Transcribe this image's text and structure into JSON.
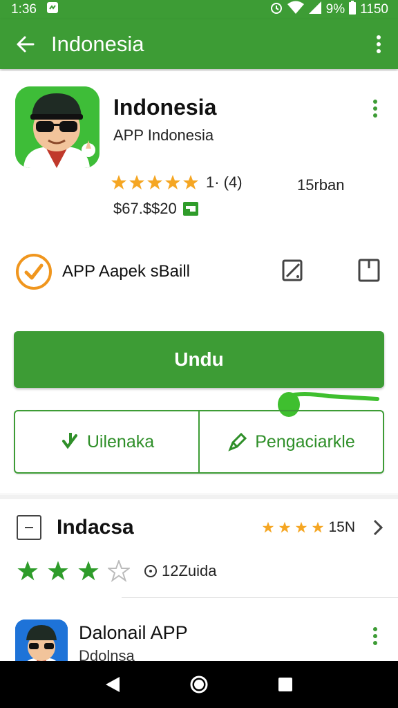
{
  "status_bar": {
    "time": "1:36",
    "battery": "9%",
    "clock_right": "1150",
    "icons": [
      "notification-icon",
      "alarm-icon",
      "wifi-icon",
      "signal-icon",
      "battery-icon"
    ]
  },
  "app_bar": {
    "title": "Indonesia",
    "back_icon": "arrow-back-icon",
    "more_icon": "more-vert-icon"
  },
  "app": {
    "name": "Indonesia",
    "developer": "APP Indonesia",
    "rating_text": "1· (4)",
    "rating_stars": 5,
    "downloads": "15rban",
    "price": "$67.$$20",
    "colors": {
      "primary": "#3d9c35",
      "star": "#f5a623",
      "verified": "#f0961e"
    }
  },
  "verified": {
    "label": "APP Aapek sBaill"
  },
  "buttons": {
    "install": "Undu",
    "action_left": "Uilenaka",
    "action_right": "Pengaciarkle"
  },
  "list": {
    "row1": {
      "title": "Indacsa",
      "count": "15N",
      "stars": 4
    },
    "row2": {
      "stars_filled": 3,
      "stars_total": 4,
      "text": "12Zuida"
    },
    "row3": {
      "title": "Dalonail APP",
      "subtitle": "Ddolnsa"
    }
  },
  "nav": {
    "back": "nav-back-icon",
    "home": "nav-home-icon",
    "recents": "nav-recents-icon"
  }
}
